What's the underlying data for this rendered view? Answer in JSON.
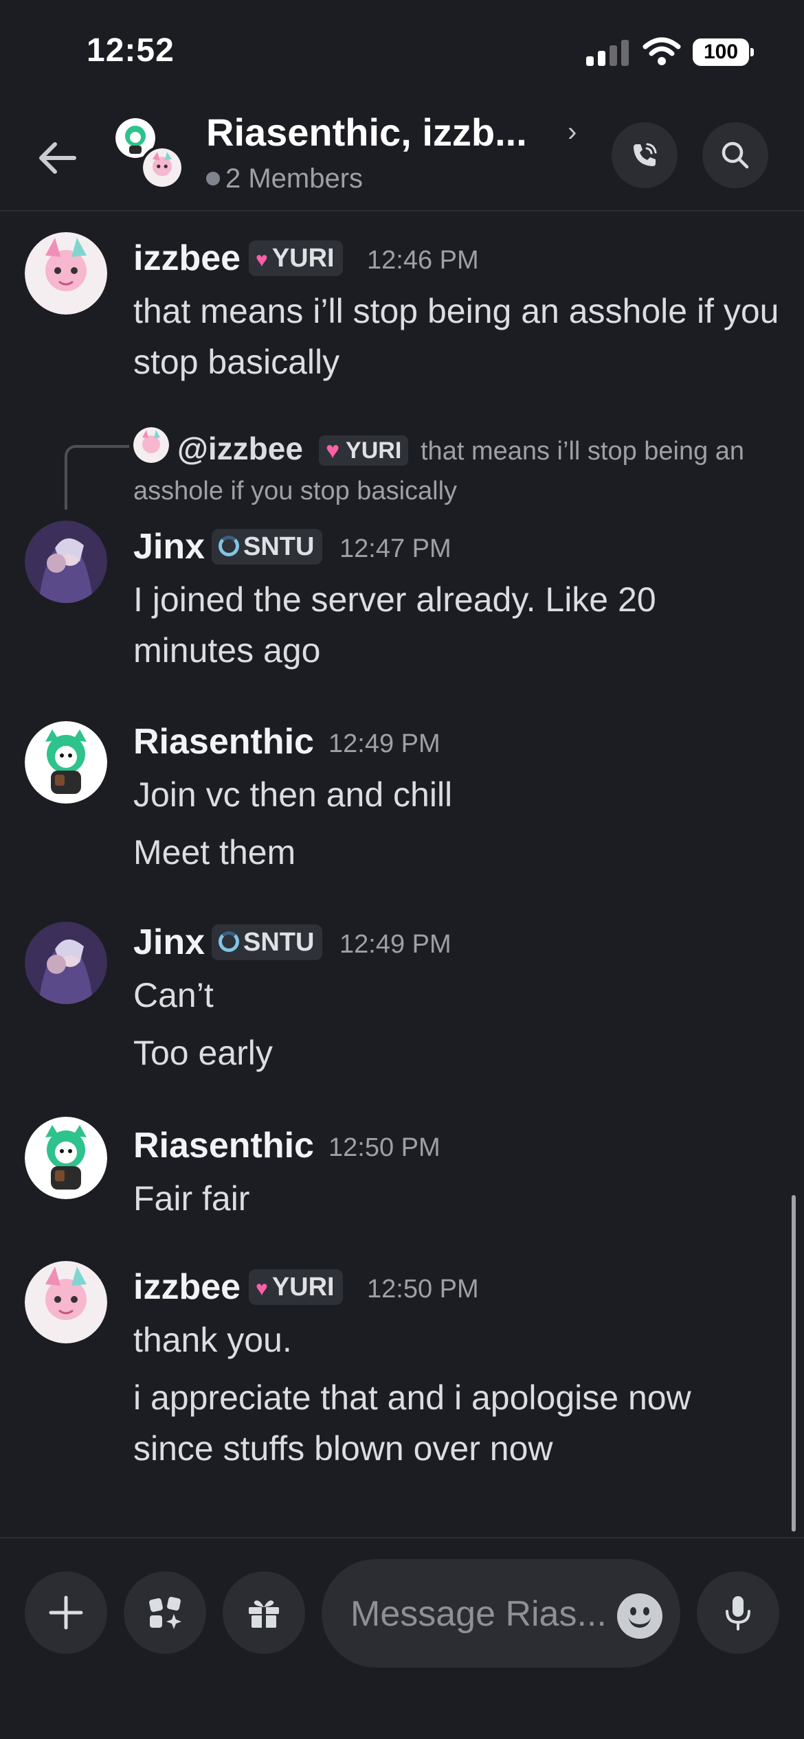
{
  "status_bar": {
    "time": "12:52",
    "battery": "100"
  },
  "header": {
    "title": "Riasenthic, izzb...",
    "subtitle": "2 Members",
    "icons": [
      "back-arrow-icon",
      "chevron-right-icon",
      "phone-call-icon",
      "search-icon"
    ]
  },
  "reply": {
    "name": "@izzbee",
    "tag": "YURI",
    "text_line1": "that means i’ll stop being an",
    "text_line2": "asshole if you stop basically"
  },
  "messages": [
    {
      "author": "izzbee",
      "tag": "YURI",
      "tag_icon": "heart",
      "time": "12:46 PM",
      "lines": [
        "that means i’ll stop being an asshole if you stop basically"
      ]
    },
    {
      "author": "Jinx",
      "tag": "SNTU",
      "tag_icon": "moon",
      "time": "12:47 PM",
      "lines": [
        "I joined the server already. Like 20 minutes ago"
      ]
    },
    {
      "author": "Riasenthic",
      "time": "12:49 PM",
      "lines": [
        "Join vc then and chill",
        "Meet them"
      ]
    },
    {
      "author": "Jinx",
      "tag": "SNTU",
      "tag_icon": "moon",
      "time": "12:49 PM",
      "lines": [
        "Can’t",
        "Too early"
      ]
    },
    {
      "author": "Riasenthic",
      "time": "12:50 PM",
      "lines": [
        "Fair fair"
      ]
    },
    {
      "author": "izzbee",
      "tag": "YURI",
      "tag_icon": "heart",
      "time": "12:50 PM",
      "lines": [
        "thank you.",
        "i appreciate that and i apologise now since stuffs blown over now"
      ]
    }
  ],
  "composer": {
    "placeholder": "Message Rias...",
    "icons": [
      "plus-icon",
      "apps-icon",
      "gift-icon",
      "emoji-icon",
      "microphone-icon"
    ]
  },
  "colors": {
    "background": "#1c1d22",
    "panel": "#2b2d33",
    "tag_bg": "#2f3138",
    "heart": "#ff5fa8",
    "text": "#dbdee1",
    "muted": "#9ea0a6"
  }
}
